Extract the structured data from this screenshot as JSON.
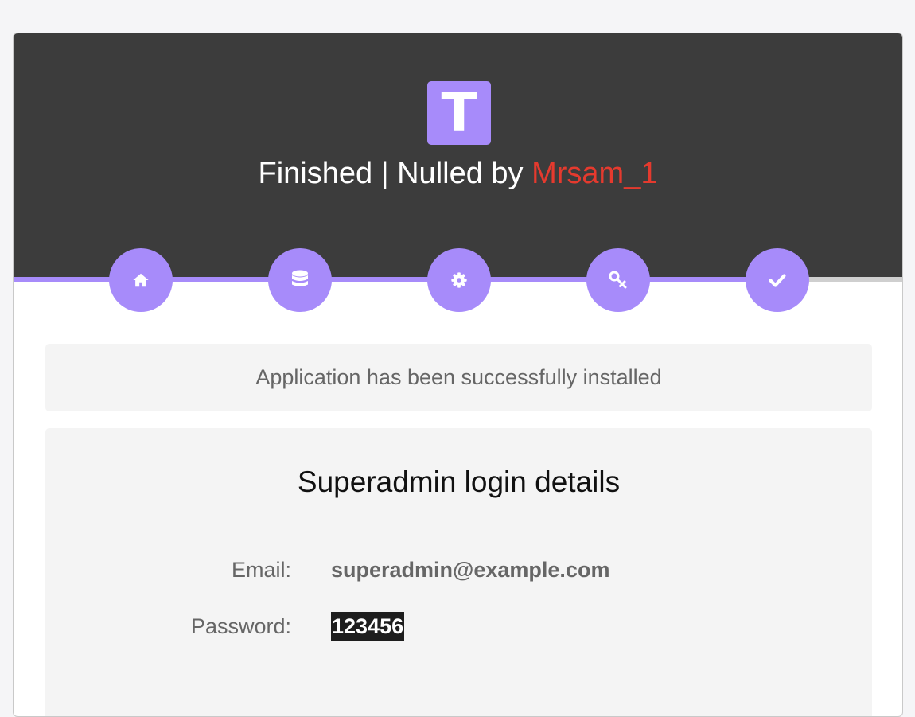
{
  "header": {
    "logo_letter": "T",
    "title_prefix": "Finished | Nulled by ",
    "title_author": "Mrsam_1",
    "accent_color": "#a78bfa",
    "author_color": "#e53a2e"
  },
  "wizard": {
    "progress": 1.0,
    "steps": [
      {
        "name": "home-icon"
      },
      {
        "name": "database-icon"
      },
      {
        "name": "gear-icon"
      },
      {
        "name": "key-icon"
      },
      {
        "name": "check-icon"
      }
    ]
  },
  "status": {
    "message": "Application has been successfully installed"
  },
  "login": {
    "heading": "Superadmin login details",
    "email_label": "Email:",
    "email_value": "superadmin@example.com",
    "password_label": "Password:",
    "password_value": "123456"
  }
}
